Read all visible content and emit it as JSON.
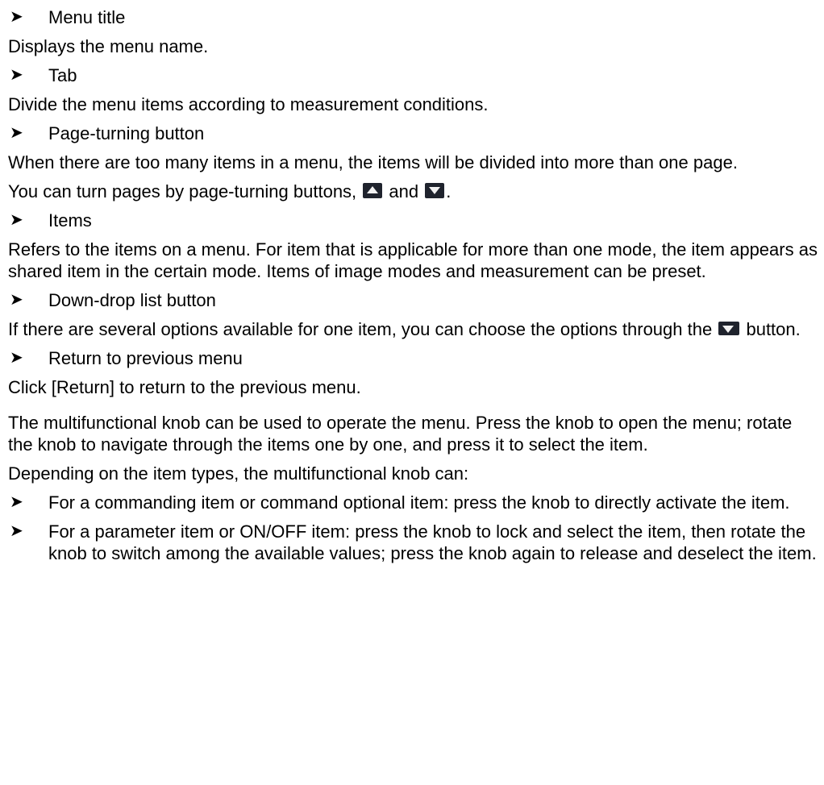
{
  "arrow_glyph": "➤",
  "sections": [
    {
      "heading": "Menu title",
      "body": [
        "Displays the menu name."
      ]
    },
    {
      "heading": "Tab",
      "body": [
        "Divide the menu items according to measurement conditions."
      ]
    },
    {
      "heading": "Page-turning button",
      "body": [
        "When there are too many items in a menu, the items will be divided into more than one page."
      ]
    },
    {
      "heading": "Items",
      "body": [
        "Refers to the items on a menu. For item that is applicable for more than one mode, the item appears as shared item in the certain mode. Items of image modes and measurement can be preset."
      ]
    },
    {
      "heading": "Down-drop list button"
    },
    {
      "heading": "Return to previous menu",
      "body": [
        "Click [Return] to return to the previous menu."
      ]
    }
  ],
  "page_turn_line": {
    "before": "You can turn pages by page-turning buttons,",
    "middle": "and",
    "after": ".",
    "icons": [
      "page-up-icon",
      "page-down-icon"
    ]
  },
  "dropdown_line": {
    "before": "If there are several options available for one item, you can choose the options through the",
    "after": "button.",
    "icon": "dropdown-arrow-icon"
  },
  "knob_paragraph": "The multifunctional knob can be used to operate the menu. Press the knob to open the menu; rotate the knob to navigate through the items one by one, and press it to select the item.",
  "depending_paragraph": "Depending on the item types, the multifunctional knob can:",
  "bullets": [
    "For a commanding item or command optional item: press the knob to directly activate the item.",
    "For a parameter item or ON/OFF item: press the knob to lock and select the item, then rotate the knob to switch among the available values; press the knob again to release and deselect the item."
  ],
  "colors": {
    "text": "#000000",
    "icon_bg": "#1f232d",
    "icon_fg": "#f2f2f2"
  }
}
